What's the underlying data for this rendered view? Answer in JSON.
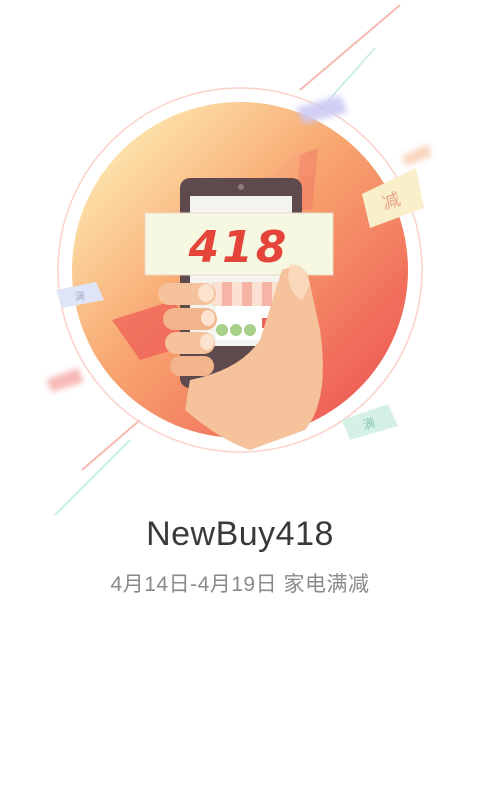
{
  "promo": {
    "badge_text": "418",
    "title": "NewBuy418",
    "subtitle": "4月14日-4月19日 家电满减",
    "coupon_labels": [
      "减",
      "满",
      "满"
    ]
  },
  "colors": {
    "circle_light": "#fde6a8",
    "circle_dark": "#f0655a",
    "badge_red": "#e5443a",
    "phone_body": "#5e4a4c",
    "hand": "#f6c29b"
  },
  "icons": [
    "confetti-icon",
    "phone-illustration",
    "hand-illustration",
    "coupon-icon"
  ]
}
